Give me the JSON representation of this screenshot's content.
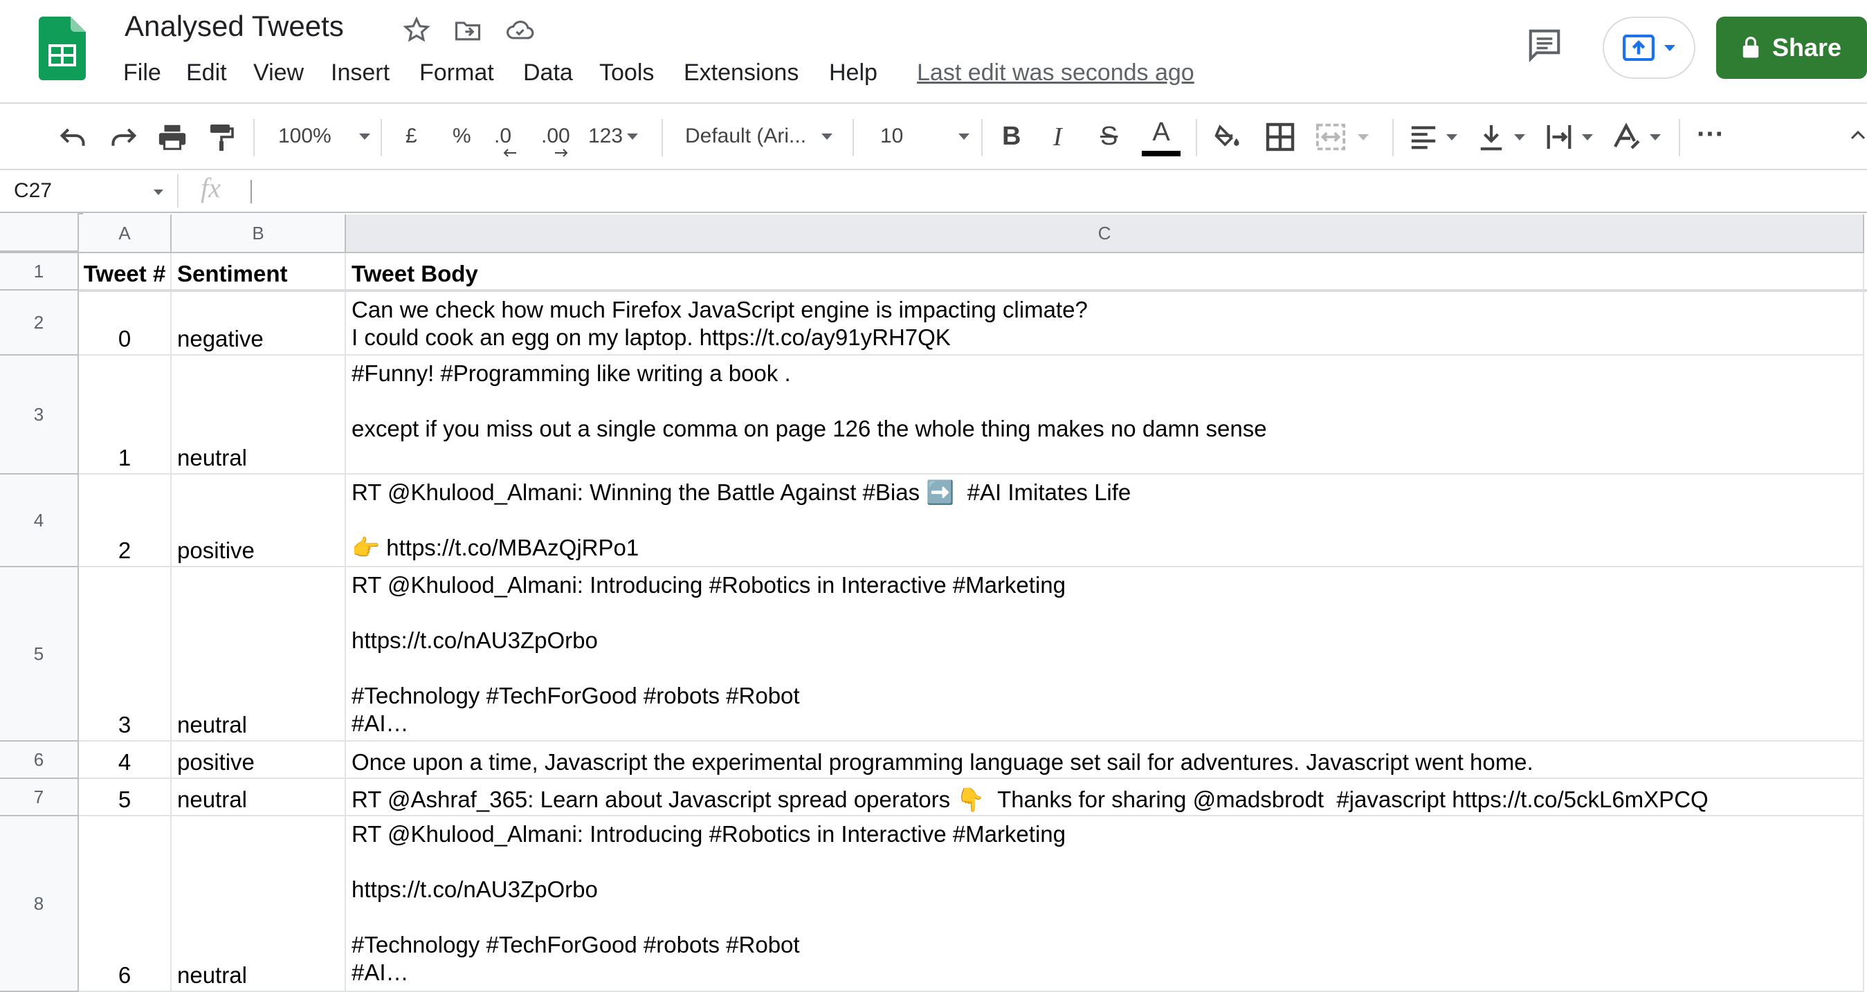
{
  "app": {
    "doc_title": "Analysed Tweets",
    "menu": [
      "File",
      "Edit",
      "View",
      "Insert",
      "Format",
      "Data",
      "Tools",
      "Extensions",
      "Help"
    ],
    "last_edit": "Last edit was seconds ago",
    "share_label": "Share"
  },
  "toolbar": {
    "zoom": "100%",
    "currency": "£",
    "percent": "%",
    "decrease_decimal": ".0",
    "increase_decimal": ".00",
    "more_formats": "123",
    "font": "Default (Ari...",
    "font_size": "10",
    "bold": "B",
    "italic": "I",
    "strike": "S",
    "text_color": "A",
    "more": "···"
  },
  "formula_bar": {
    "cell_ref": "C27",
    "fx": "fx",
    "value": ""
  },
  "columns": [
    "A",
    "B",
    "C"
  ],
  "rows": [
    {
      "num": "1",
      "a": "Tweet #",
      "b": "Sentiment",
      "c": "Tweet Body"
    },
    {
      "num": "2",
      "a": "0",
      "b": "negative",
      "c": "Can we check how much Firefox JavaScript engine is impacting climate?\nI could cook an egg on my laptop. https://t.co/ay91yRH7QK"
    },
    {
      "num": "3",
      "a": "1",
      "b": "neutral",
      "c": "#Funny! #Programming like writing a book .\n\nexcept if you miss out a single comma on page 126 the whole thing makes no damn sense"
    },
    {
      "num": "4",
      "a": "2",
      "b": "positive",
      "c": "RT @Khulood_Almani: Winning the Battle Against #Bias ➡️  #AI Imitates Life\n\n👉 https://t.co/MBAzQjRPo1"
    },
    {
      "num": "5",
      "a": "3",
      "b": "neutral",
      "c": "RT @Khulood_Almani: Introducing #Robotics in Interactive #Marketing\n\nhttps://t.co/nAU3ZpOrbo\n\n#Technology #TechForGood #robots #Robot\n#AI…"
    },
    {
      "num": "6",
      "a": "4",
      "b": "positive",
      "c": "Once upon a time, Javascript the experimental programming language set sail for adventures. Javascript went home."
    },
    {
      "num": "7",
      "a": "5",
      "b": "neutral",
      "c": "RT @Ashraf_365: Learn about Javascript spread operators 👇  Thanks for sharing @madsbrodt  #javascript https://t.co/5ckL6mXPCQ"
    },
    {
      "num": "8",
      "a": "6",
      "b": "neutral",
      "c": "RT @Khulood_Almani: Introducing #Robotics in Interactive #Marketing\n\nhttps://t.co/nAU3ZpOrbo\n\n#Technology #TechForGood #robots #Robot\n#AI…"
    }
  ],
  "colors": {
    "sheets_green": "#0f9d58",
    "share_green": "#2e7d32",
    "header_gray": "#f8f9fa",
    "selected_col_header": "#e8eaed",
    "accent_blue": "#1a73e8"
  }
}
